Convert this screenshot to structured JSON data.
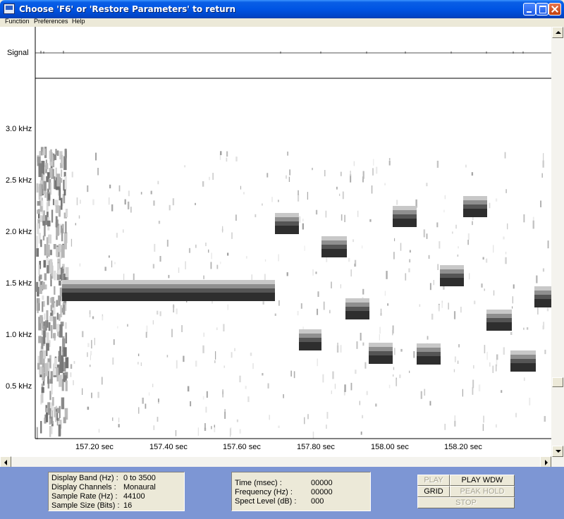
{
  "window": {
    "title": "Choose 'F6' or 'Restore Parameters' to return"
  },
  "menu": [
    "Function",
    "Preferences",
    "Help"
  ],
  "spectrogram": {
    "signal_label": "Signal",
    "freq_labels": [
      "3.0 kHz",
      "2.5 kHz",
      "2.0 kHz",
      "1.5 kHz",
      "1.0 kHz",
      "0.5 kHz"
    ],
    "time_labels": [
      "157.20 sec",
      "157.40 sec",
      "157.60 sec",
      "157.80 sec",
      "158.00 sec",
      "158.20 sec"
    ]
  },
  "info_left": [
    {
      "label": "Display Band (Hz) :",
      "value": "0 to 3500"
    },
    {
      "label": "Display Channels :",
      "value": "Monaural"
    },
    {
      "label": "Sample Rate (Hz) :",
      "value": "44100"
    },
    {
      "label": "Sample Size (Bits) :",
      "value": "16"
    }
  ],
  "info_mid": [
    {
      "label": "Time (msec) :",
      "value": "00000"
    },
    {
      "label": "Frequency (Hz) :",
      "value": "00000"
    },
    {
      "label": "Spect Level (dB) :",
      "value": "000"
    }
  ],
  "buttons": {
    "play": "PLAY",
    "play_wdw": "PLAY WDW",
    "grid": "GRID",
    "peak_hold": "PEAK HOLD",
    "stop": "STOP"
  },
  "colors": {
    "title_bar": "#0054e3",
    "bottom_panel": "#7d96d4",
    "tone": "#3a3a3a"
  }
}
